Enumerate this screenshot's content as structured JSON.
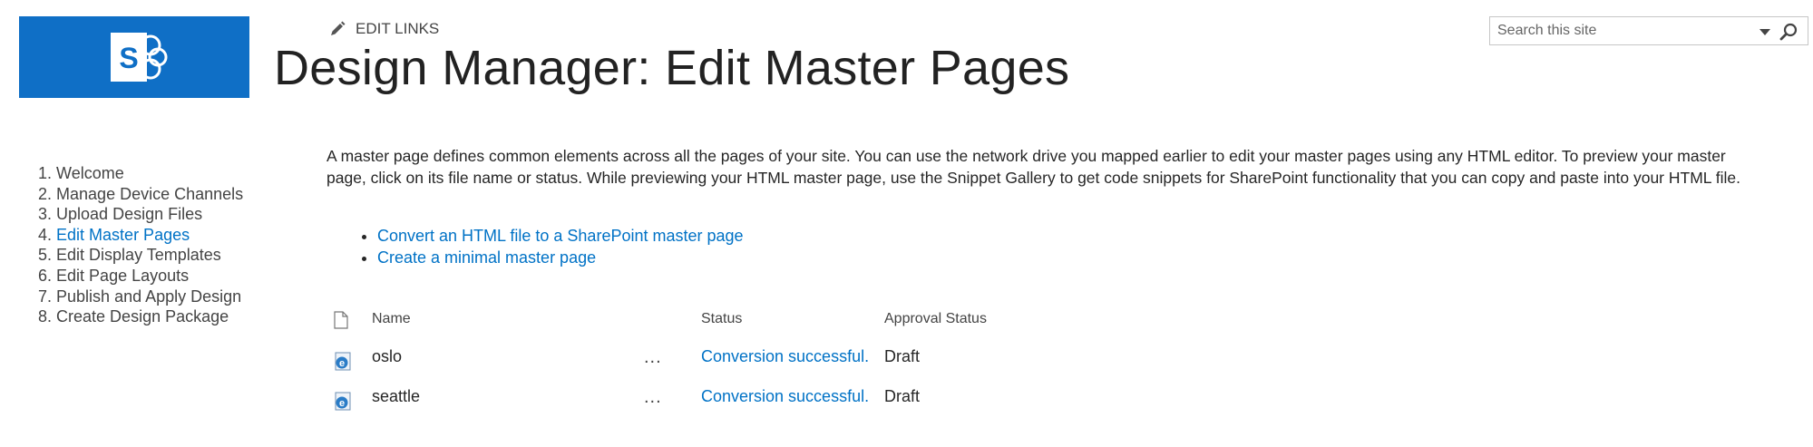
{
  "header": {
    "edit_links_label": "EDIT LINKS",
    "page_title": "Design Manager: Edit Master Pages",
    "search_placeholder": "Search this site",
    "logo_letter": "S"
  },
  "colors": {
    "brand": "#0f6fc6",
    "link": "#0072c6",
    "text": "#444444"
  },
  "steps": [
    {
      "num": "1.",
      "label": "Welcome",
      "active": false
    },
    {
      "num": "2.",
      "label": "Manage Device Channels",
      "active": false
    },
    {
      "num": "3.",
      "label": "Upload Design Files",
      "active": false
    },
    {
      "num": "4.",
      "label": "Edit Master Pages",
      "active": true
    },
    {
      "num": "5.",
      "label": "Edit Display Templates",
      "active": false
    },
    {
      "num": "6.",
      "label": "Edit Page Layouts",
      "active": false
    },
    {
      "num": "7.",
      "label": "Publish and Apply Design",
      "active": false
    },
    {
      "num": "8.",
      "label": "Create Design Package",
      "active": false
    }
  ],
  "main": {
    "intro": "A master page defines common elements across all the pages of your site. You can use the network drive you mapped earlier to edit your master pages using any HTML editor. To preview your master page, click on its file name or status. While previewing your HTML master page, use the Snippet Gallery to get code snippets for SharePoint functionality that you can copy and paste into your HTML file.",
    "links": [
      "Convert an HTML file to a SharePoint master page",
      "Create a minimal master page"
    ]
  },
  "table": {
    "columns": {
      "name": "Name",
      "status": "Status",
      "approval": "Approval Status"
    },
    "rows": [
      {
        "name": "oslo",
        "more": "...",
        "status": "Conversion successful.",
        "approval": "Draft",
        "icon": "html-file-icon"
      },
      {
        "name": "seattle",
        "more": "...",
        "status": "Conversion successful.",
        "approval": "Draft",
        "icon": "html-file-icon"
      }
    ]
  }
}
